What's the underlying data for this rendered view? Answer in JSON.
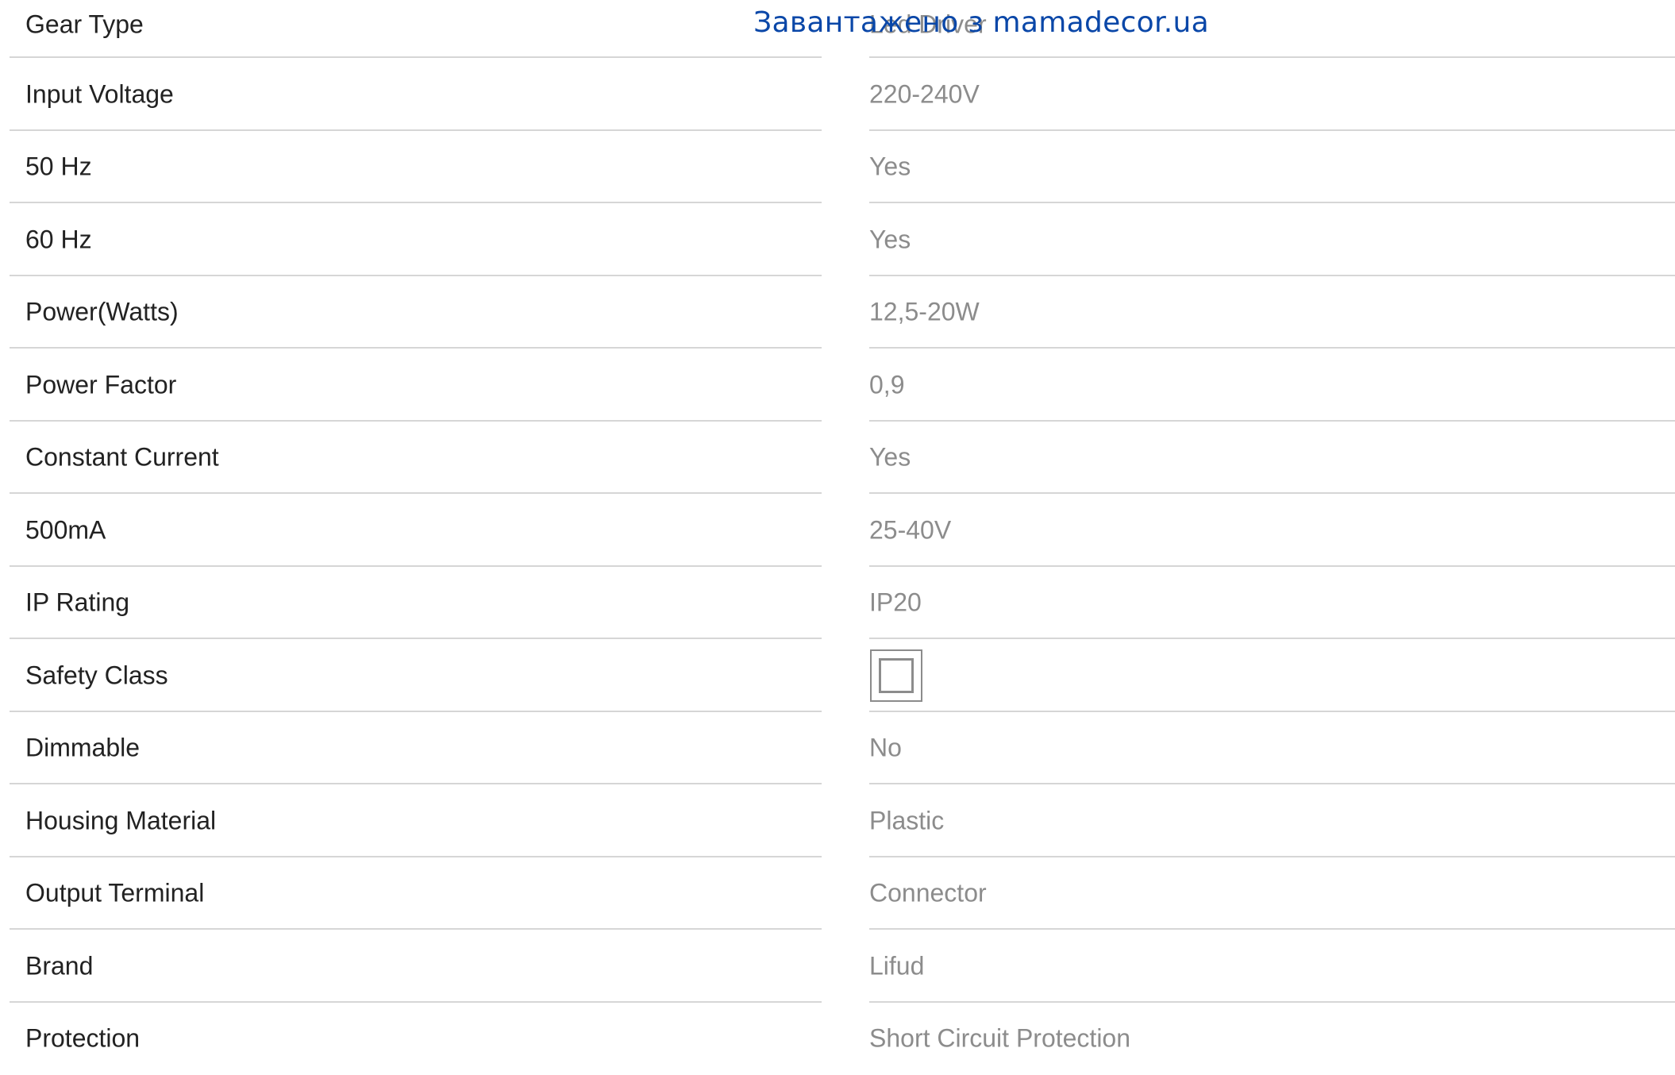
{
  "watermark": "Завантажено з mamadecor.ua",
  "specs": [
    {
      "label": "Gear Type",
      "value": "Led Driver"
    },
    {
      "label": "Input Voltage",
      "value": "220-240V"
    },
    {
      "label": "50 Hz",
      "value": "Yes"
    },
    {
      "label": "60 Hz",
      "value": "Yes"
    },
    {
      "label": "Power(Watts)",
      "value": "12,5-20W"
    },
    {
      "label": "Power Factor",
      "value": "0,9"
    },
    {
      "label": "Constant Current",
      "value": "Yes"
    },
    {
      "label": "500mA",
      "value": "25-40V"
    },
    {
      "label": "IP Rating",
      "value": "IP20"
    },
    {
      "label": "Safety Class",
      "value": "",
      "icon": "class-ii-double-square-icon"
    },
    {
      "label": "Dimmable",
      "value": "No"
    },
    {
      "label": "Housing Material",
      "value": "Plastic"
    },
    {
      "label": "Output Terminal",
      "value": "Connector"
    },
    {
      "label": "Brand",
      "value": "Lifud"
    },
    {
      "label": "Protection",
      "value": "Short Circuit Protection"
    }
  ],
  "colors": {
    "label_text": "#222222",
    "value_text": "#8c8c8c",
    "divider": "#d6d6d6",
    "watermark": "#0a47a8"
  }
}
